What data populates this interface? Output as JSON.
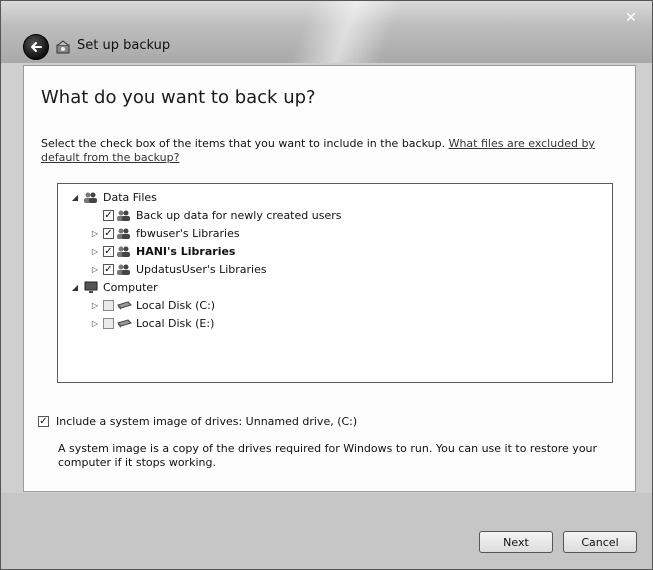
{
  "window": {
    "title": "Set up backup"
  },
  "page": {
    "heading": "What do you want to back up?",
    "instructions": "Select the check box of the items that you want to include in the backup. ",
    "instructions_link": "What files are excluded by default from the backup?"
  },
  "tree": {
    "data_files": {
      "label": "Data Files",
      "children": [
        {
          "label": "Back up data for newly created users",
          "checked": true
        },
        {
          "label": "fbwuser's Libraries",
          "checked": true
        },
        {
          "label": "HANI's Libraries",
          "checked": true
        },
        {
          "label": "UpdatusUser's Libraries",
          "checked": true
        }
      ]
    },
    "computer": {
      "label": "Computer",
      "children": [
        {
          "label": "Local Disk (C:)",
          "checked": false
        },
        {
          "label": "Local Disk (E:)",
          "checked": false
        }
      ]
    }
  },
  "system_image": {
    "label": "Include a system image of drives: Unnamed drive, (C:)",
    "checked": true,
    "description": "A system image is a copy of the drives required for Windows to run. You can use it to restore your computer if it stops working."
  },
  "buttons": {
    "next": "Next",
    "cancel": "Cancel"
  }
}
